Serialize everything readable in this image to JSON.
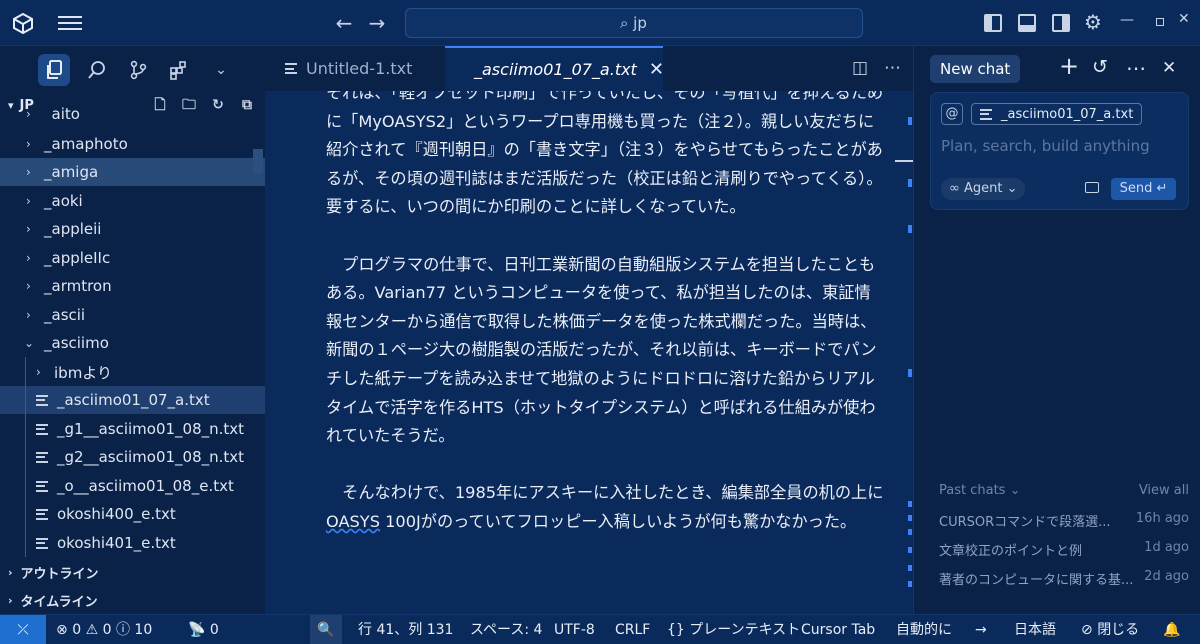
{
  "titlebar": {
    "search_text": "jp"
  },
  "sidebar": {
    "root_label": "JP",
    "items": [
      {
        "label": "_aito",
        "kind": "folder",
        "indent": 0
      },
      {
        "label": "_amaphoto",
        "kind": "folder",
        "indent": 0
      },
      {
        "label": "_amiga",
        "kind": "folder",
        "indent": 0
      },
      {
        "label": "_aoki",
        "kind": "folder",
        "indent": 0
      },
      {
        "label": "_appleii",
        "kind": "folder",
        "indent": 0
      },
      {
        "label": "_appleIIc",
        "kind": "folder",
        "indent": 0
      },
      {
        "label": "_armtron",
        "kind": "folder",
        "indent": 0
      },
      {
        "label": "_ascii",
        "kind": "folder",
        "indent": 0
      },
      {
        "label": "_asciimo",
        "kind": "folder-open",
        "indent": 0
      },
      {
        "label": "ibmより",
        "kind": "folder",
        "indent": 1
      },
      {
        "label": "_asciimo01_07_a.txt",
        "kind": "file",
        "indent": 1
      },
      {
        "label": "_g1__asciimo01_08_n.txt",
        "kind": "file",
        "indent": 1
      },
      {
        "label": "_g2__asciimo01_08_n.txt",
        "kind": "file",
        "indent": 1
      },
      {
        "label": "_o__asciimo01_08_e.txt",
        "kind": "file",
        "indent": 1
      },
      {
        "label": "okoshi400_e.txt",
        "kind": "file",
        "indent": 1
      },
      {
        "label": "okoshi401_e.txt",
        "kind": "file",
        "indent": 1
      }
    ],
    "outline_label": "アウトライン",
    "timeline_label": "タイムライン"
  },
  "tabs": [
    {
      "label": "Untitled-1.txt"
    },
    {
      "label": "_asciimo01_07_a.txt"
    }
  ],
  "editor": {
    "paragraphs": [
      "それは、「軽オフセット印刷」で作っていたし、その「写植代」を抑えるために「MyOASYS2」というワープロ専用機も買った（注２）。親しい友だちに紹介されて『週刊朝日』の「書き文字」（注３）をやらせてもらったことがあるが、その頃の週刊誌はまだ活版だった（校正は鉛と清刷りでやってくる）。要するに、いつの間にか印刷のことに詳しくなっていた。",
      "　プログラマの仕事で、日刊工業新聞の自動組版システムを担当したこともある。Varian77 というコンピュータを使って、私が担当したのは、東証情報センターから通信で取得した株価データを使った株式欄だった。当時は、新聞の１ページ大の樹脂製の活版だったが、それ以前は、キーボードでパンチした紙テープを読み込ませて地獄のようにドロドロに溶けた鉛からリアルタイムで活字を作るHTS（ホットタイプシステム）と呼ばれる仕組みが使われていたそうだ。"
    ],
    "p3_a": "　そんなわけで、1985年にアスキーに入社したとき、編集部全員の机の上に",
    "p3_squiggle": "OASYS",
    "p3_b": " 100Jがのっていてフロッピー入稿しいようが何も驚かなかった。"
  },
  "chat": {
    "new_chat_label": "New chat",
    "file_chip": "_asciimo01_07_a.txt",
    "placeholder": "Plan, search, build anything",
    "agent_label": "Agent",
    "send_label": "Send",
    "past_chats_label": "Past chats",
    "view_all_label": "View all",
    "past_chats": [
      {
        "title": "CURSORコマンドで段落選...",
        "time": "16h ago"
      },
      {
        "title": "文章校正のポイントと例",
        "time": "1d ago"
      },
      {
        "title": "著者のコンピュータに関する基...",
        "time": "2d ago"
      }
    ]
  },
  "statusbar": {
    "errors": "0",
    "warnings": "0",
    "info": "10",
    "ports": "0",
    "position": "行 41、列 131",
    "spaces": "スペース: 4",
    "encoding": "UTF-8",
    "eol": "CRLF",
    "language": "プレーンテキスト",
    "cursor_tab": "Cursor Tab",
    "auto": "自動的に",
    "lang_mode": "日本語",
    "close_label": "閉じる"
  },
  "colors": {
    "accent": "#3b82f6",
    "background": "#0a2148",
    "editor": "#0b2a5c"
  }
}
